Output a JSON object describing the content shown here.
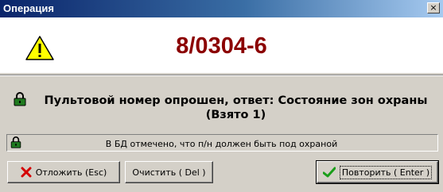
{
  "window": {
    "title": "Операция",
    "close_glyph": "×"
  },
  "header": {
    "case_number": "8/0304-6",
    "warning_icon": "warning-triangle-icon"
  },
  "status": {
    "message": "Пультовой номер опрошен, ответ: Состояние зон охраны (Взято 1)",
    "icon": "padlock-icon"
  },
  "info": {
    "message": "В БД отмечено, что п/н должен быть под охраной",
    "icon": "padlock-icon"
  },
  "buttons": {
    "postpone_label": "Отложить (Esc)",
    "clear_label": "Очистить ( Del )",
    "repeat_label": "Повторить ( Enter )"
  },
  "colors": {
    "case_number": "#8b0000",
    "titlebar_start": "#0a246a",
    "titlebar_end": "#a6caf0",
    "dialog_face": "#d4d0c8"
  }
}
